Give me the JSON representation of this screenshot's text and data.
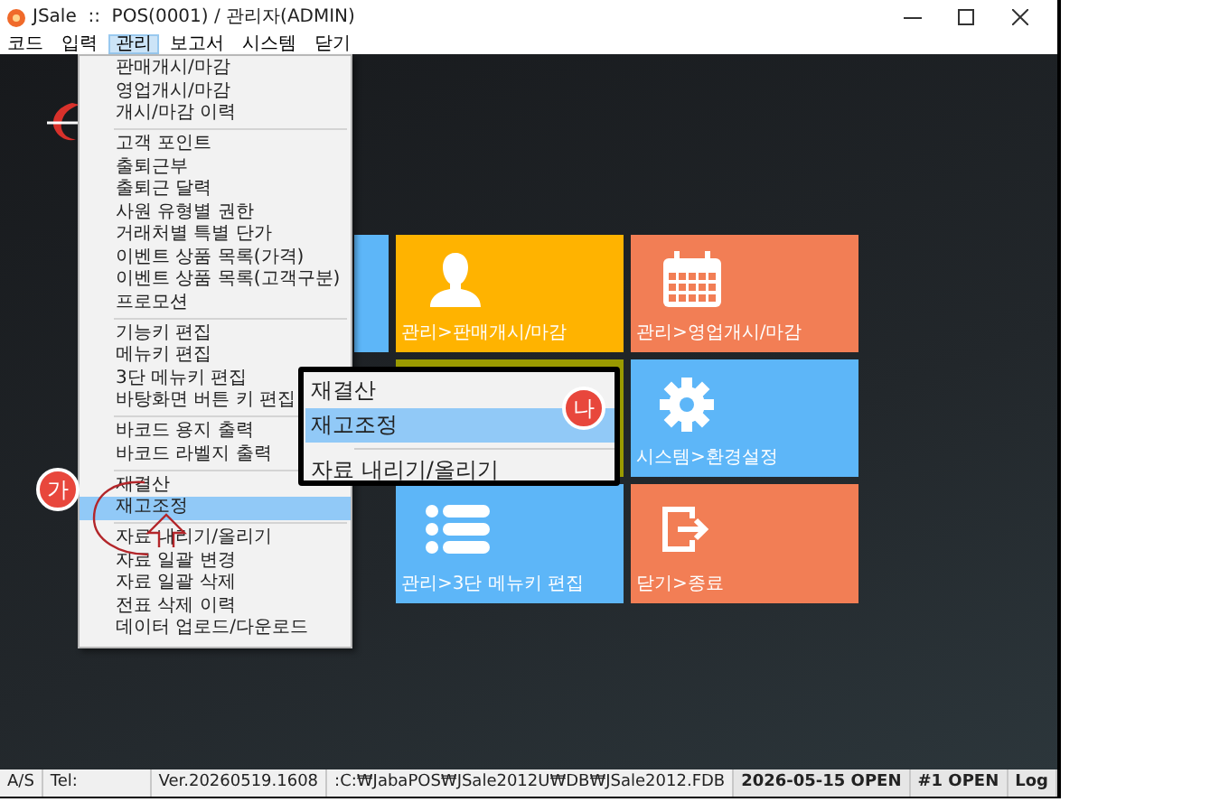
{
  "window": {
    "title": "JSale  ::  POS(0001) / 관리자(ADMIN)"
  },
  "menubar": [
    {
      "label": "코드",
      "selected": false
    },
    {
      "label": "입력",
      "selected": false
    },
    {
      "label": "관리",
      "selected": true
    },
    {
      "label": "보고서",
      "selected": false
    },
    {
      "label": "시스템",
      "selected": false
    },
    {
      "label": "닫기",
      "selected": false
    }
  ],
  "dropdown": {
    "items": [
      {
        "kind": "item",
        "label": "판매개시/마감",
        "selected": false
      },
      {
        "kind": "item",
        "label": "영업개시/마감",
        "selected": false
      },
      {
        "kind": "item",
        "label": "개시/마감 이력",
        "selected": false
      },
      {
        "kind": "separator"
      },
      {
        "kind": "item",
        "label": "고객 포인트",
        "selected": false
      },
      {
        "kind": "item",
        "label": "출퇴근부",
        "selected": false
      },
      {
        "kind": "item",
        "label": "출퇴근 달력",
        "selected": false
      },
      {
        "kind": "item",
        "label": "사원 유형별 권한",
        "selected": false
      },
      {
        "kind": "item",
        "label": "거래처별 특별 단가",
        "selected": false
      },
      {
        "kind": "item",
        "label": "이벤트 상품 목록(가격)",
        "selected": false
      },
      {
        "kind": "item",
        "label": "이벤트 상품 목록(고객구분)",
        "selected": false
      },
      {
        "kind": "item",
        "label": "프로모션",
        "selected": false
      },
      {
        "kind": "separator"
      },
      {
        "kind": "item",
        "label": "기능키 편집",
        "selected": false
      },
      {
        "kind": "item",
        "label": "메뉴키 편집",
        "selected": false
      },
      {
        "kind": "item",
        "label": "3단 메뉴키 편집",
        "selected": false
      },
      {
        "kind": "item",
        "label": "바탕화면 버튼 키 편집",
        "selected": false
      },
      {
        "kind": "separator"
      },
      {
        "kind": "item",
        "label": "바코드 용지 출력",
        "selected": false
      },
      {
        "kind": "item",
        "label": "바코드 라벨지 출력",
        "selected": false
      },
      {
        "kind": "separator"
      },
      {
        "kind": "item",
        "label": "재결산",
        "selected": false
      },
      {
        "kind": "item",
        "label": "재고조정",
        "selected": true
      },
      {
        "kind": "separator"
      },
      {
        "kind": "item",
        "label": "자료 내리기/올리기",
        "selected": false
      },
      {
        "kind": "item",
        "label": "자료 일괄 변경",
        "selected": false
      },
      {
        "kind": "item",
        "label": "자료 일괄 삭제",
        "selected": false
      },
      {
        "kind": "item",
        "label": "전표 삭제 이력",
        "selected": false
      },
      {
        "kind": "item",
        "label": "데이터 업로드/다운로드",
        "selected": false
      }
    ]
  },
  "tiles": [
    {
      "kind": "blank",
      "color": "#5db6f8"
    },
    {
      "kind": "person",
      "label": "관리>판매개시/마감",
      "color": "#ffb300"
    },
    {
      "kind": "calendar",
      "label": "관리>영업개시/마감",
      "color": "#f27e55"
    },
    {
      "kind": "empty"
    },
    {
      "kind": "blank",
      "color": "#9a9a00"
    },
    {
      "kind": "gear",
      "label": "시스템>환경설정",
      "color": "#5db6f8"
    },
    {
      "kind": "empty"
    },
    {
      "kind": "list",
      "label": "관리>3단 메뉴키 편집",
      "color": "#5db6f8"
    },
    {
      "kind": "exit",
      "label": "닫기>종료",
      "color": "#f27e55"
    }
  ],
  "callout": {
    "badge": "나",
    "items": [
      {
        "label": "재결산",
        "selected": false
      },
      {
        "label": "재고조정",
        "selected": true
      },
      {
        "label": "자료 내리기/올리기",
        "selected": false
      }
    ]
  },
  "marker": {
    "badge": "가"
  },
  "status_bar": [
    {
      "kind": "plain",
      "text": "A/S"
    },
    {
      "kind": "plain",
      "text": "Tel:"
    },
    {
      "kind": "plain",
      "text": "Ver.20260519.1608"
    },
    {
      "kind": "plain",
      "text": ":C:₩JabaPOS₩JSale2012U₩DB₩JSale2012.FDB"
    },
    {
      "kind": "bold",
      "text": "2026-05-15 OPEN"
    },
    {
      "kind": "bold",
      "text": "#1 OPEN"
    },
    {
      "kind": "bold",
      "text": "Log"
    }
  ]
}
